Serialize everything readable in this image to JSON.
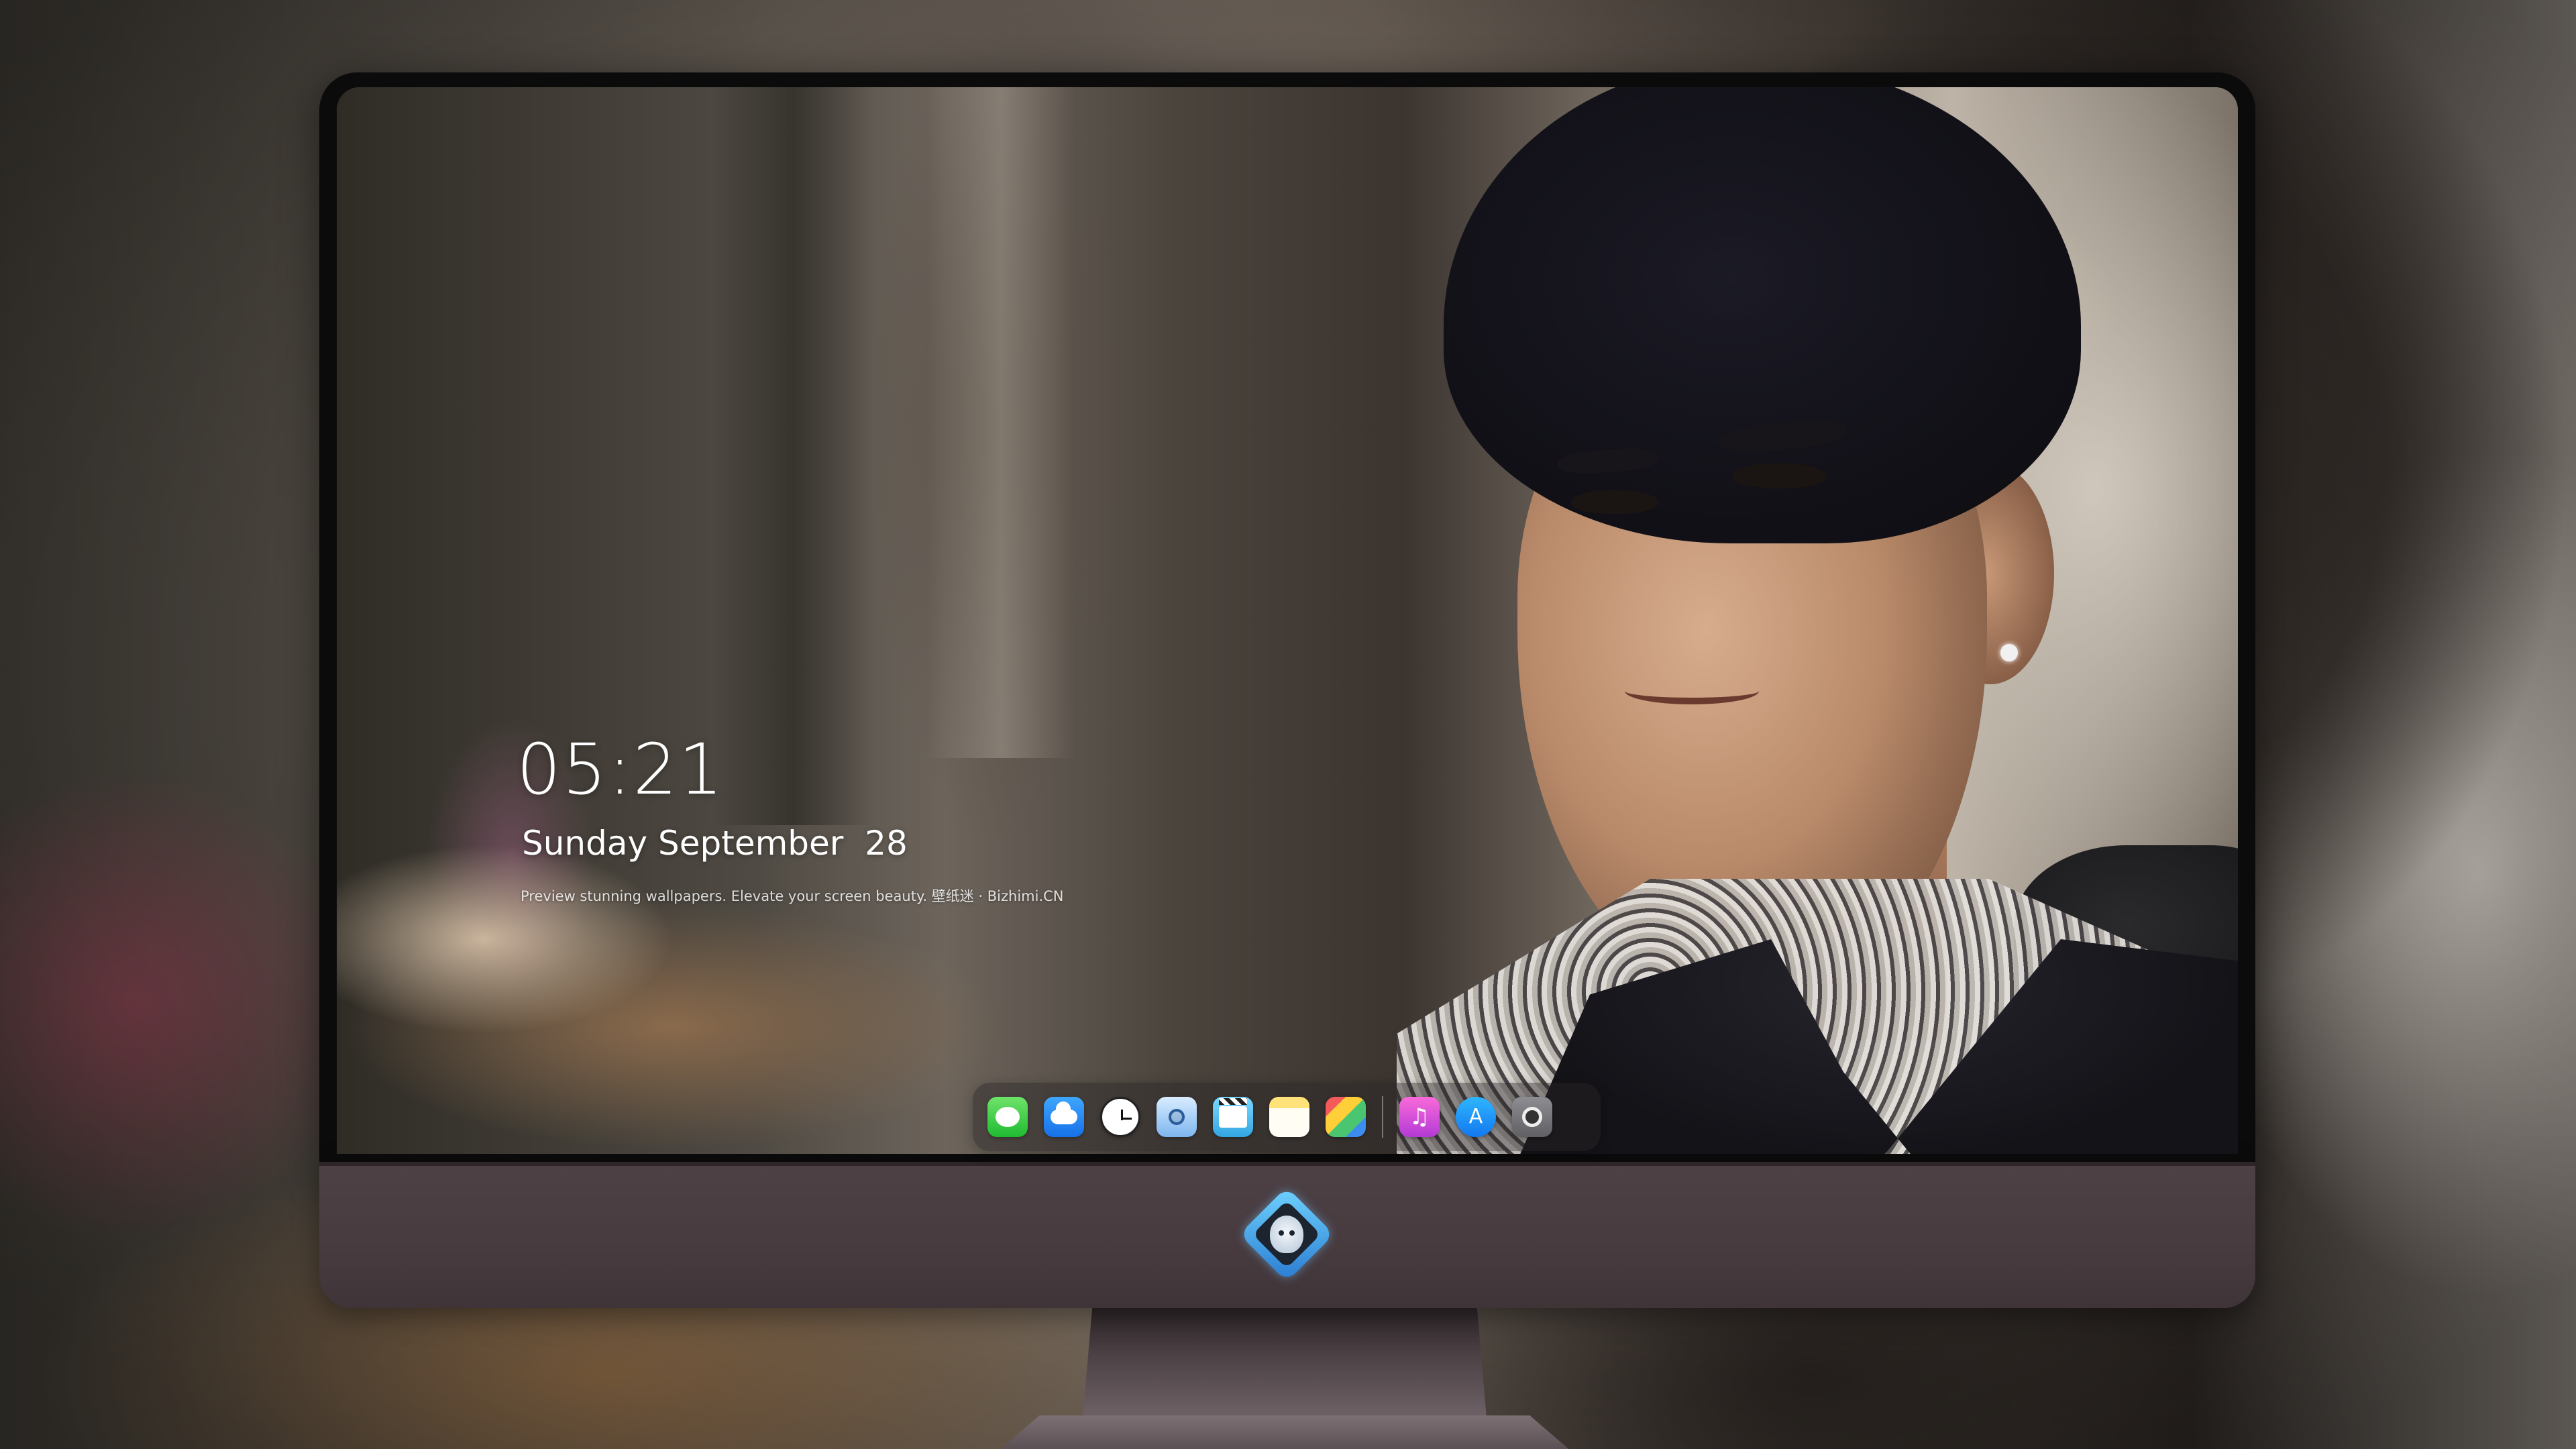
{
  "lock_screen": {
    "time": "05:21",
    "date": "Sunday September  28",
    "tagline": "Preview stunning wallpapers. Elevate your screen beauty. 壁纸迷 · Bizhimi.CN"
  },
  "dock": {
    "apps": [
      {
        "name": "Messages",
        "icon": "messages-icon"
      },
      {
        "name": "Weather",
        "icon": "weather-icon"
      },
      {
        "name": "Clock",
        "icon": "clock-icon"
      },
      {
        "name": "Preview",
        "icon": "preview-icon"
      },
      {
        "name": "Clips",
        "icon": "clapperboard-icon"
      },
      {
        "name": "Notes",
        "icon": "notes-icon"
      },
      {
        "name": "Photo Booth",
        "icon": "photo-booth-icon"
      },
      {
        "name": "Music",
        "icon": "music-icon"
      },
      {
        "name": "App Store",
        "icon": "app-store-icon"
      },
      {
        "name": "Camera",
        "icon": "camera-icon"
      }
    ]
  },
  "colors": {
    "text": "#ffffff",
    "monitor_chin": "#4a3e42",
    "bezel": "#0b0b0c",
    "logo_accent": "#2a7bd0"
  }
}
